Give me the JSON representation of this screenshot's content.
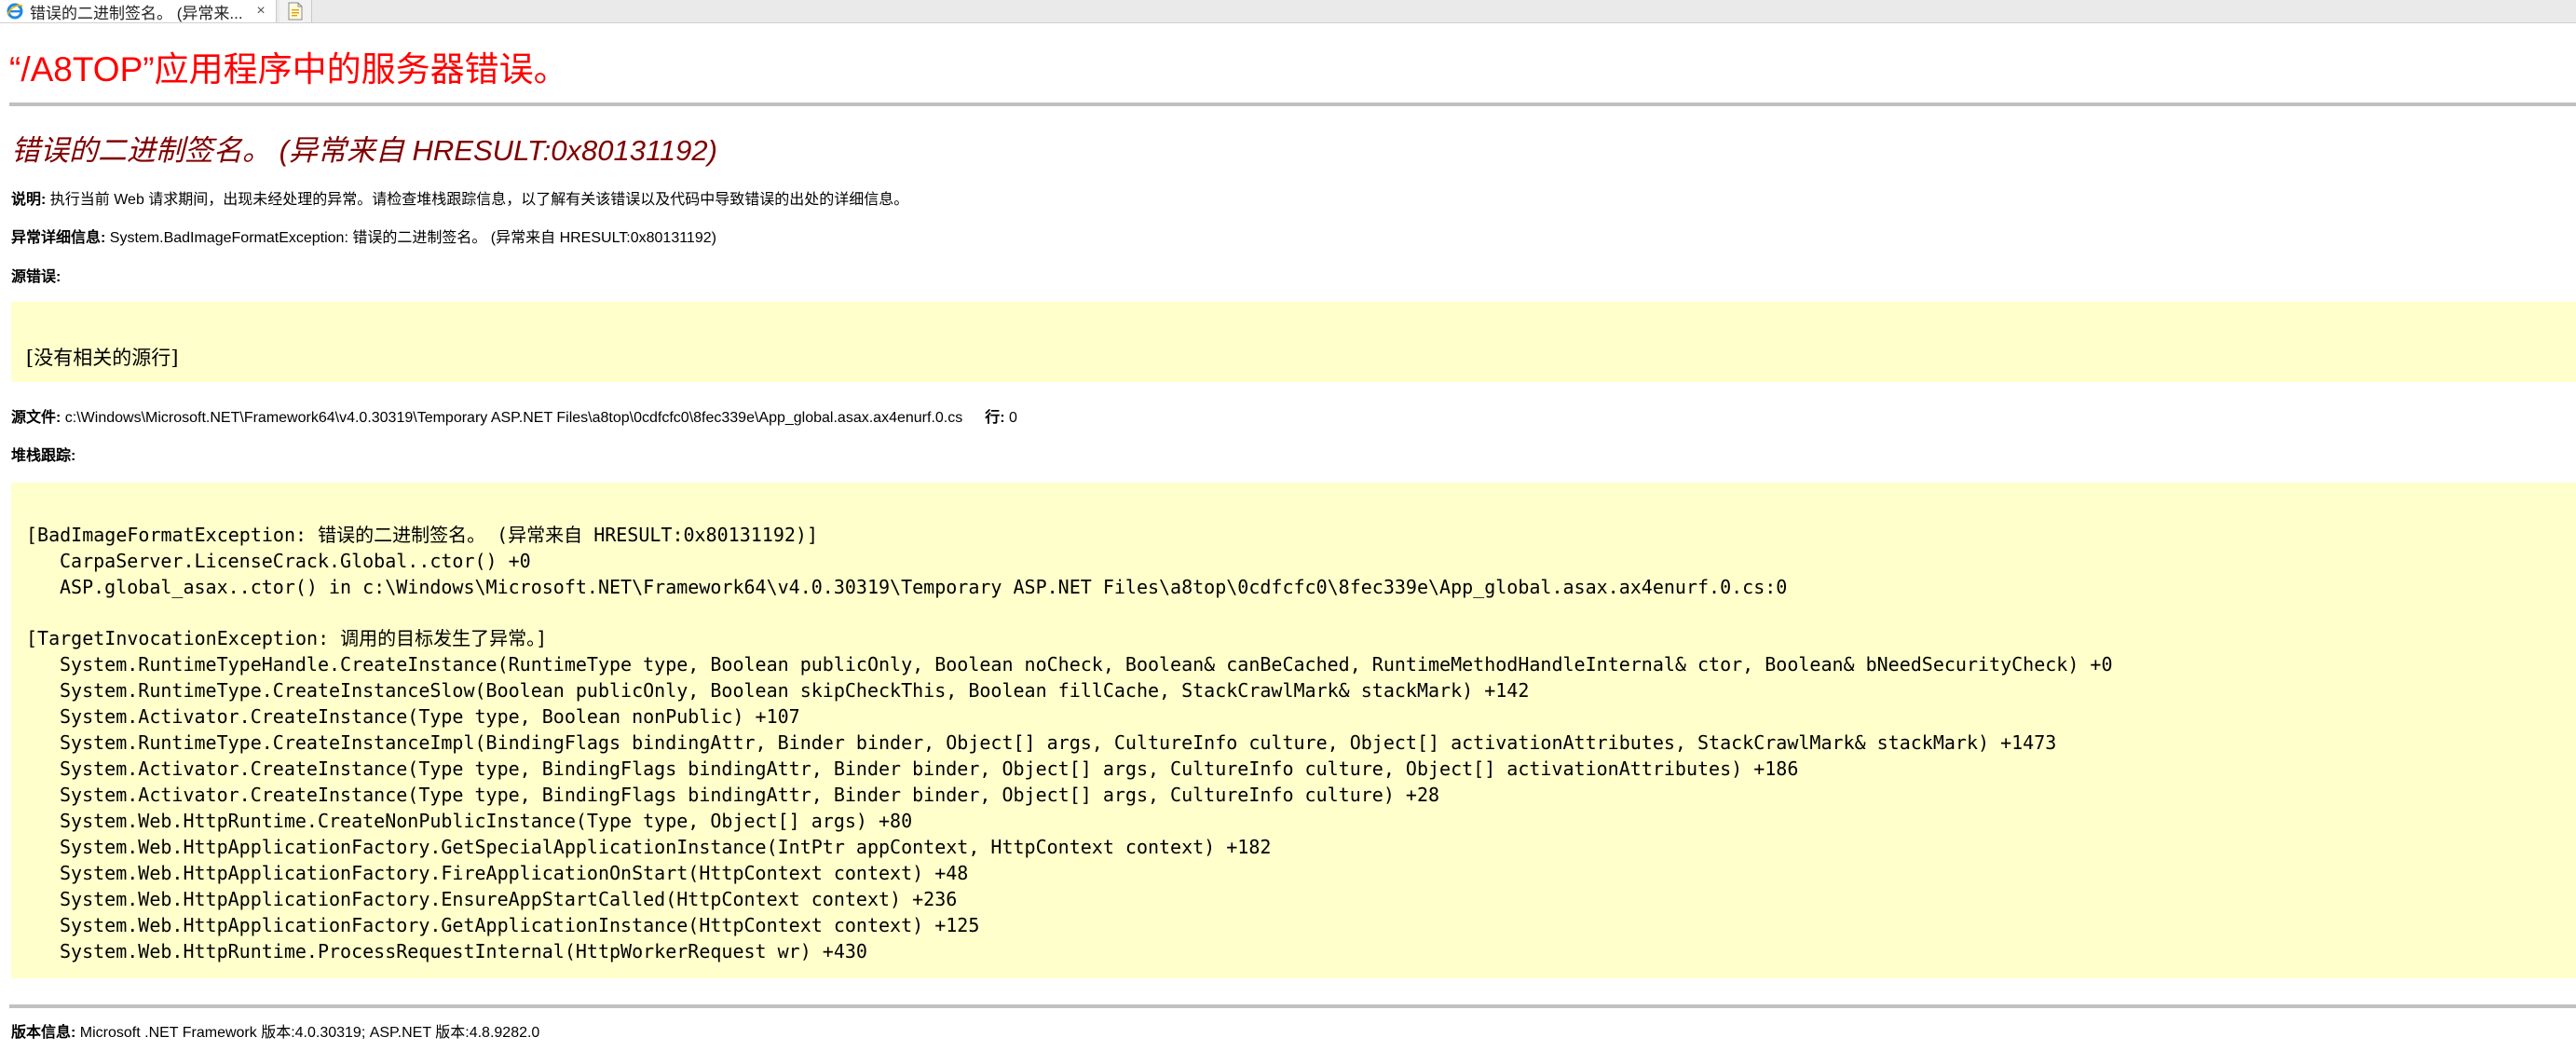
{
  "browser": {
    "tab_title": "错误的二进制签名。 (异常来...",
    "tab_close": "×"
  },
  "page": {
    "title": "“/A8TOP”应用程序中的服务器错误。",
    "error_title": "错误的二进制签名。 (异常来自 HRESULT:0x80131192)",
    "description_label": "说明:",
    "description_text": " 执行当前 Web 请求期间，出现未经处理的异常。请检查堆栈跟踪信息，以了解有关该错误以及代码中导致错误的出处的详细信息。",
    "exception_label": "异常详细信息:",
    "exception_text": " System.BadImageFormatException: 错误的二进制签名。 (异常来自 HRESULT:0x80131192)",
    "source_error_label": "源错误:",
    "source_error_text": "[没有相关的源行]",
    "source_file_label": "源文件:",
    "source_file_path": " c:\\Windows\\Microsoft.NET\\Framework64\\v4.0.30319\\Temporary ASP.NET Files\\a8top\\0cdfcfc0\\8fec339e\\App_global.asax.ax4enurf.0.cs",
    "line_label": "行:",
    "line_value": " 0",
    "stack_trace_label": "堆栈跟踪:",
    "version_label": "版本信息:",
    "version_text": " Microsoft .NET Framework 版本:4.0.30319; ASP.NET 版本:4.8.9282.0"
  },
  "stack_trace": {
    "exception1": "[BadImageFormatException: 错误的二进制签名。 (异常来自 HRESULT:0x80131192)]",
    "frames1": [
      "CarpaServer.LicenseCrack.Global..ctor() +0",
      "ASP.global_asax..ctor() in c:\\Windows\\Microsoft.NET\\Framework64\\v4.0.30319\\Temporary ASP.NET Files\\a8top\\0cdfcfc0\\8fec339e\\App_global.asax.ax4enurf.0.cs:0"
    ],
    "exception2": "[TargetInvocationException: 调用的目标发生了异常。]",
    "frames2": [
      "System.RuntimeTypeHandle.CreateInstance(RuntimeType type, Boolean publicOnly, Boolean noCheck, Boolean& canBeCached, RuntimeMethodHandleInternal& ctor, Boolean& bNeedSecurityCheck) +0",
      "System.RuntimeType.CreateInstanceSlow(Boolean publicOnly, Boolean skipCheckThis, Boolean fillCache, StackCrawlMark& stackMark) +142",
      "System.Activator.CreateInstance(Type type, Boolean nonPublic) +107",
      "System.RuntimeType.CreateInstanceImpl(BindingFlags bindingAttr, Binder binder, Object[] args, CultureInfo culture, Object[] activationAttributes, StackCrawlMark& stackMark) +1473",
      "System.Activator.CreateInstance(Type type, BindingFlags bindingAttr, Binder binder, Object[] args, CultureInfo culture, Object[] activationAttributes) +186",
      "System.Activator.CreateInstance(Type type, BindingFlags bindingAttr, Binder binder, Object[] args, CultureInfo culture) +28",
      "System.Web.HttpRuntime.CreateNonPublicInstance(Type type, Object[] args) +80",
      "System.Web.HttpApplicationFactory.GetSpecialApplicationInstance(IntPtr appContext, HttpContext context) +182",
      "System.Web.HttpApplicationFactory.FireApplicationOnStart(HttpContext context) +48",
      "System.Web.HttpApplicationFactory.EnsureAppStartCalled(HttpContext context) +236",
      "System.Web.HttpApplicationFactory.GetApplicationInstance(HttpContext context) +125",
      "System.Web.HttpRuntime.ProcessRequestInternal(HttpWorkerRequest wr) +430"
    ]
  },
  "icons": {
    "tab_icon": "ie-browser-icon",
    "new_tab_icon": "new-tab-icon"
  },
  "colors": {
    "title": "#ff0000",
    "error_title": "#800000",
    "code_background": "#ffffcc"
  }
}
